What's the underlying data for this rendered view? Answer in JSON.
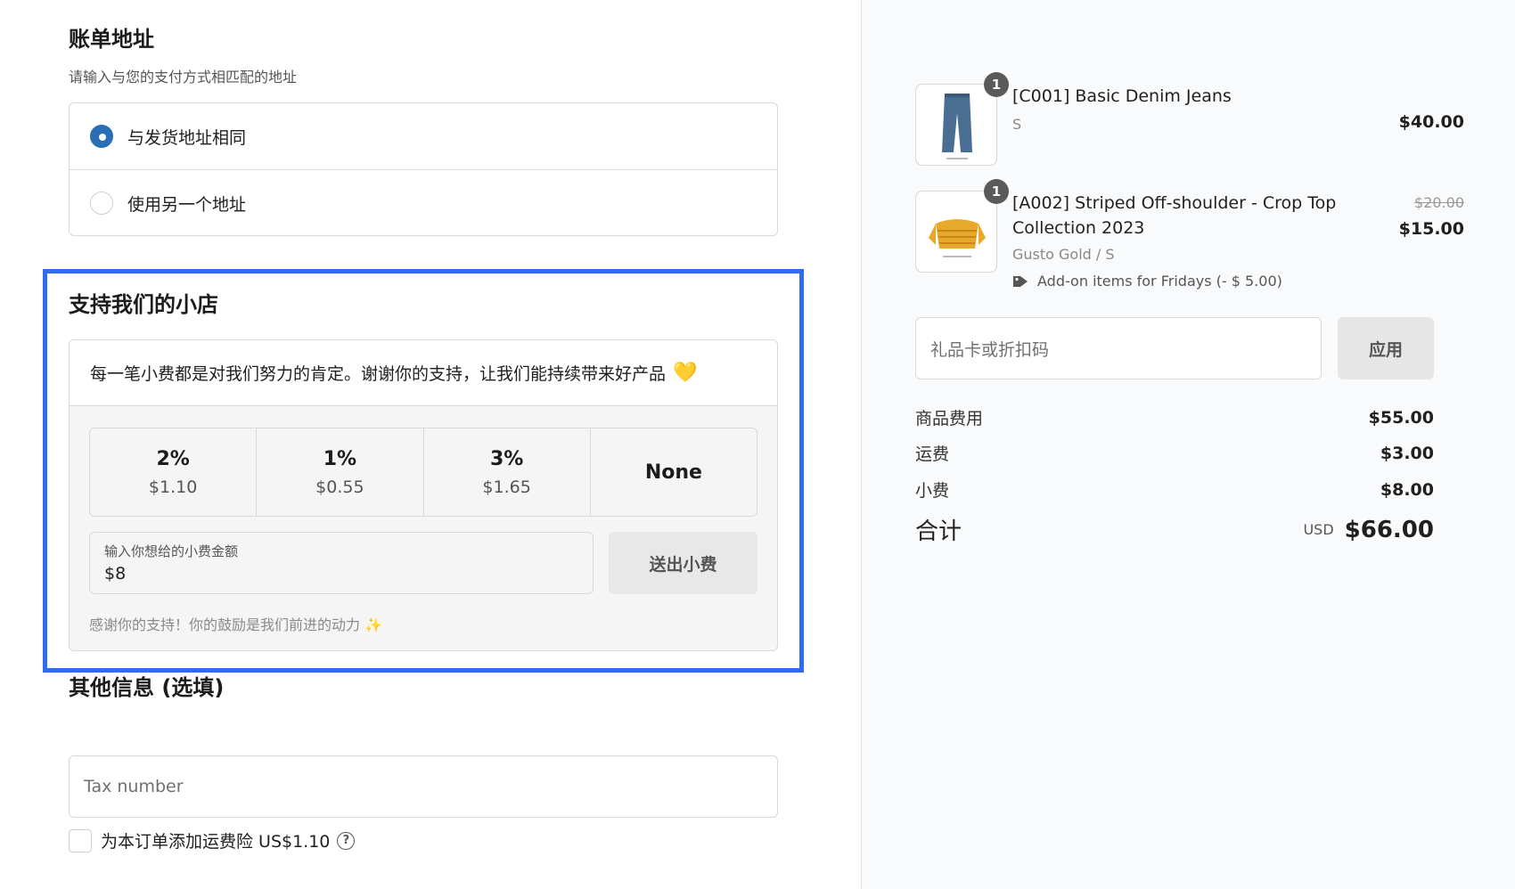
{
  "billing": {
    "title": "账单地址",
    "subtitle": "请输入与您的支付方式相匹配的地址",
    "options": [
      {
        "label": "与发货地址相同",
        "selected": true
      },
      {
        "label": "使用另一个地址",
        "selected": false
      }
    ]
  },
  "tip": {
    "title": "支持我们的小店",
    "message": "每一笔小费都是对我们努力的肯定。谢谢你的支持，让我们能持续带来好产品",
    "heart": "💛",
    "options": [
      {
        "pct": "2%",
        "amount": "$1.10"
      },
      {
        "pct": "1%",
        "amount": "$0.55"
      },
      {
        "pct": "3%",
        "amount": "$1.65"
      }
    ],
    "none_label": "None",
    "custom_label": "输入你想给的小费金额",
    "custom_value": "$8",
    "send_label": "送出小费",
    "thanks": "感谢你的支持！你的鼓励是我们前进的动力",
    "sparkle": "✨"
  },
  "other": {
    "title": "其他信息 (选填)",
    "tax_placeholder": "Tax number",
    "insurance_label": "为本订单添加运费险 US$1.10",
    "help_glyph": "?"
  },
  "cart": {
    "items": [
      {
        "qty": "1",
        "title": "[C001] Basic Denim Jeans",
        "variant": "S",
        "price": "$40.00"
      },
      {
        "qty": "1",
        "title": "[A002] Striped Off-shoulder - Crop Top Collection 2023",
        "variant": "Gusto Gold / S",
        "old_price": "$20.00",
        "price": "$15.00",
        "discount": "Add-on items for Fridays (- $ 5.00)"
      }
    ],
    "code_placeholder": "礼品卡或折扣码",
    "apply_label": "应用",
    "subtotal_label": "商品费用",
    "subtotal": "$55.00",
    "shipping_label": "运费",
    "shipping": "$3.00",
    "tip_label": "小费",
    "tip": "$8.00",
    "total_label": "合计",
    "currency": "USD",
    "total": "$66.00"
  },
  "colors": {
    "accent": "#2a6fb5",
    "highlight": "#2f6bf0",
    "jeans": "#4a6d92",
    "crop_top": "#e8a92a"
  }
}
